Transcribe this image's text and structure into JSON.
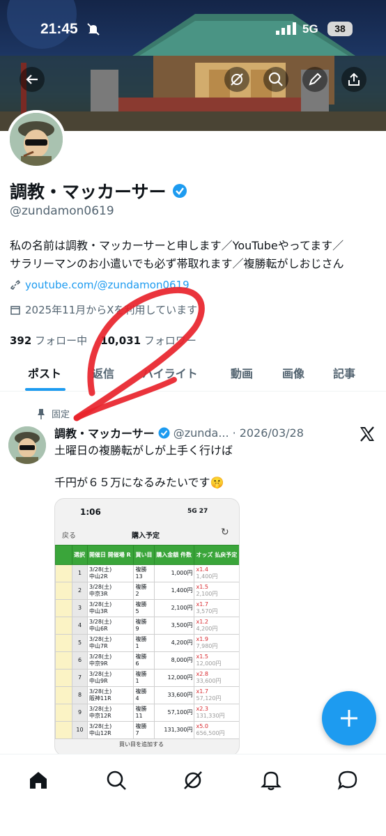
{
  "status_bar": {
    "time": "21:45",
    "network": "5G",
    "battery": "38"
  },
  "header_buttons": [
    "back-arrow-icon",
    "grok-icon",
    "search-icon",
    "pencil-icon",
    "share-icon"
  ],
  "profile": {
    "name": "調教・マッカーサー",
    "handle": "@zundamon0619",
    "bio_line1": "私の名前は調教・マッカーサーと申します／YouTubeやってます／",
    "bio_line2": "サラリーマンのお小遣いでも必ず帯取れます／複勝転がしおじさん",
    "link": "youtube.com/@zundamon0619",
    "joined": "2025年11月からXを利用しています",
    "following_count": "392",
    "following_label": "フォロー中",
    "followers_count": "10,031",
    "followers_label": "フォロワー"
  },
  "tabs": [
    "ポスト",
    "返信",
    "ハイライト",
    "動画",
    "画像",
    "記事"
  ],
  "active_tab": "ポスト",
  "colors": {
    "accent": "#1d9bf0",
    "annotation": "#e8232b",
    "table_header": "#3aa53a"
  },
  "post": {
    "pinned_label": "固定",
    "author": "調教・マッカーサー",
    "handle_short": "@zunda...",
    "date": "2026/03/28",
    "line1": "土曜日の複勝転がしが上手く行けば",
    "line2": "千円が６５万になるみたいです🤫",
    "screenshot": {
      "time": "1:06",
      "status": "5G 27",
      "back": "戻る",
      "title": "購入予定",
      "headers": [
        "選択",
        "開催日\n開催場 R",
        "買い目",
        "購入金額\n件数",
        "オッズ\n払戻予定"
      ],
      "rows": [
        {
          "no": "1",
          "date": "3/28(土)",
          "venue": "中山2R",
          "bet": "複勝",
          "sel": "13",
          "amount": "1,000円",
          "odds": "x1.4",
          "payout": "1,400円"
        },
        {
          "no": "2",
          "date": "3/28(土)",
          "venue": "中京3R",
          "bet": "複勝",
          "sel": "2",
          "amount": "1,400円",
          "odds": "x1.5",
          "payout": "2,100円"
        },
        {
          "no": "3",
          "date": "3/28(土)",
          "venue": "中山3R",
          "bet": "複勝",
          "sel": "5",
          "amount": "2,100円",
          "odds": "x1.7",
          "payout": "3,570円"
        },
        {
          "no": "4",
          "date": "3/28(土)",
          "venue": "中山6R",
          "bet": "複勝",
          "sel": "9",
          "amount": "3,500円",
          "odds": "x1.2",
          "payout": "4,200円"
        },
        {
          "no": "5",
          "date": "3/28(土)",
          "venue": "中山7R",
          "bet": "複勝",
          "sel": "1",
          "amount": "4,200円",
          "odds": "x1.9",
          "payout": "7,980円"
        },
        {
          "no": "6",
          "date": "3/28(土)",
          "venue": "中京9R",
          "bet": "複勝",
          "sel": "6",
          "amount": "8,000円",
          "odds": "x1.5",
          "payout": "12,000円"
        },
        {
          "no": "7",
          "date": "3/28(土)",
          "venue": "中山9R",
          "bet": "複勝",
          "sel": "1",
          "amount": "12,000円",
          "odds": "x2.8",
          "payout": "33,600円"
        },
        {
          "no": "8",
          "date": "3/28(土)",
          "venue": "阪神11R",
          "bet": "複勝",
          "sel": "4",
          "amount": "33,600円",
          "odds": "x1.7",
          "payout": "57,120円"
        },
        {
          "no": "9",
          "date": "3/28(土)",
          "venue": "中京12R",
          "bet": "複勝",
          "sel": "11",
          "amount": "57,100円",
          "odds": "x2.3",
          "payout": "131,330円"
        },
        {
          "no": "10",
          "date": "3/28(土)",
          "venue": "中山12R",
          "bet": "複勝",
          "sel": "7",
          "amount": "131,300円",
          "odds": "x5.0",
          "payout": "656,500円"
        }
      ],
      "add_label": "買い目を追加する",
      "date_tab": "3/28(土)"
    }
  },
  "bottom_nav": [
    "home-icon",
    "search-icon",
    "grok-icon",
    "notifications-icon",
    "messages-icon"
  ]
}
